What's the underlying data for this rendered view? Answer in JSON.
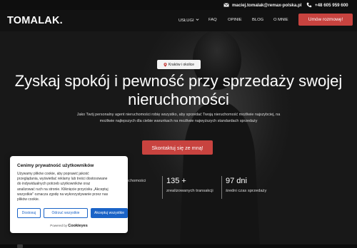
{
  "topbar": {
    "email": "maciej.tomalak@remax-polska.pl",
    "phone": "+48 605 959 600",
    "email_icon": "envelope-icon",
    "phone_icon": "phone-icon"
  },
  "header": {
    "logo": "TOMALAK.",
    "nav": [
      {
        "label": "USŁUGI",
        "has_dropdown": true
      },
      {
        "label": "FAQ"
      },
      {
        "label": "OPINIE"
      },
      {
        "label": "BLOG"
      },
      {
        "label": "O MNIE"
      }
    ],
    "cta_label": "Umów rozmowę!"
  },
  "hero": {
    "badge_label": "Kraków i okolice",
    "badge_icon": "map-pin-icon",
    "headline_line1": "Zyskaj spokój i pewność przy sprzedaży swojej",
    "headline_line2": "nieruchomości",
    "subtext_line1": "Jako Twój personalny agent nieruchomości robię wszystko, aby sprzedać Twoją nieruchomość możliwie najszybciej, na",
    "subtext_line2": "możliwie najlepszych dla ciebie warunkach na możliwie najwyższych standardach sprzedaży",
    "cta_label": "Skontaktuj się ze mną!"
  },
  "stats": [
    {
      "number": "",
      "label": "nieruchomości"
    },
    {
      "number": "135 +",
      "label": "zrealizowanych transakcji"
    },
    {
      "number": "97 dni",
      "label": "średni czas sprzedaży"
    }
  ],
  "cookie_banner": {
    "title": "Cenimy prywatność użytkowników",
    "body_lines": [
      "Używamy plików cookie, aby poprawić jakość",
      "przeglądania, wyświetlać reklamy lub treści dostosowane",
      "do indywidualnych potrzeb użytkowników oraz",
      "analizować ruch na stronie. Kliknięcie przycisku „Akceptuj",
      "wszystkie\" oznacza zgodę na wykorzystywanie przez nas",
      "plików cookie."
    ],
    "buttons": {
      "customize": "Dostosuj",
      "reject": "Odrzuć wszystkie",
      "accept": "Akceptuj wszystkie"
    },
    "powered_prefix": "Powered by",
    "powered_brand": "Cookieyes"
  },
  "colors": {
    "accent": "#c8433f",
    "cookie_blue": "#1a63c7",
    "header_bg": "#121212"
  }
}
